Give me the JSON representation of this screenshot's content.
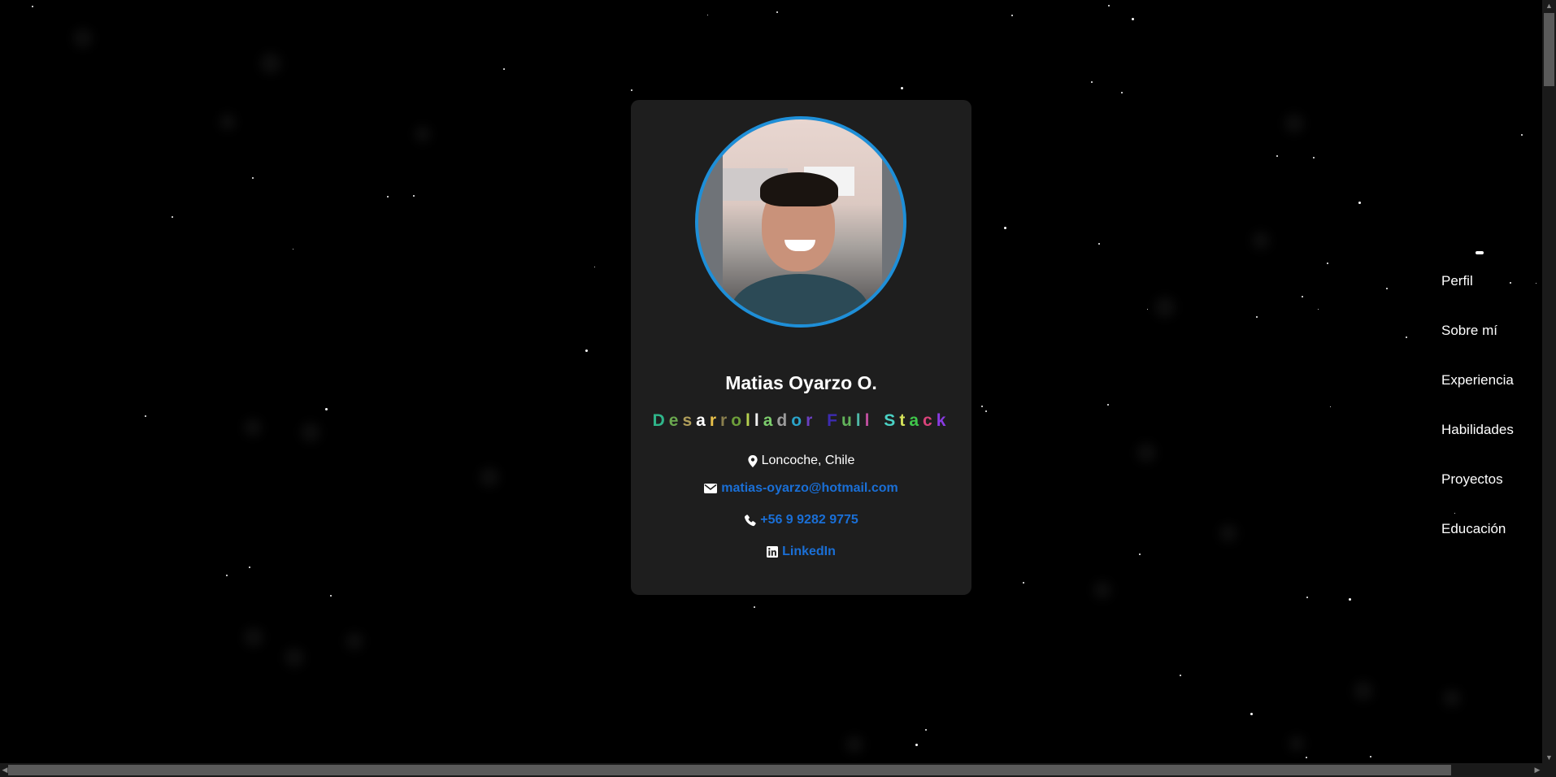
{
  "profile": {
    "name": "Matias Oyarzo O.",
    "role_letters": [
      "D",
      "e",
      "s",
      "a",
      "r",
      "r",
      "o",
      "l",
      "l",
      "a",
      "d",
      "o",
      "r",
      " ",
      "F",
      "u",
      "l",
      "l",
      " ",
      "S",
      "t",
      "a",
      "c",
      "k"
    ],
    "role_colors": [
      "#2fb58a",
      "#6aa84f",
      "#b09e5a",
      "#ffffff",
      "#e8c04a",
      "#8a7f4e",
      "#6d9e3a",
      "#b7d14f",
      "#f0f0f0",
      "#7ccc6c",
      "#9c9c9c",
      "#2aa3c9",
      "#6a3fc0",
      "#ffffff",
      "#3d2bb0",
      "#62b35a",
      "#4fb8a8",
      "#c14f9f",
      "#ffffff",
      "#4ad1c4",
      "#d6e35b",
      "#3fc64a",
      "#d9437a",
      "#8a3be2"
    ],
    "location": "Loncoche, Chile",
    "email": "matias-oyarzo@hotmail.com",
    "phone": "+56 9 9282 9775",
    "linkedin": "LinkedIn",
    "accent_color": "#1e8fd8",
    "link_color": "#1a6fd6"
  },
  "nav": {
    "items": [
      "Perfil",
      "Sobre mí",
      "Experiencia",
      "Habilidades",
      "Proyectos",
      "Educación"
    ]
  },
  "icons": {
    "location": "map-marker-icon",
    "email": "envelope-icon",
    "phone": "phone-icon",
    "linkedin": "linkedin-icon"
  }
}
